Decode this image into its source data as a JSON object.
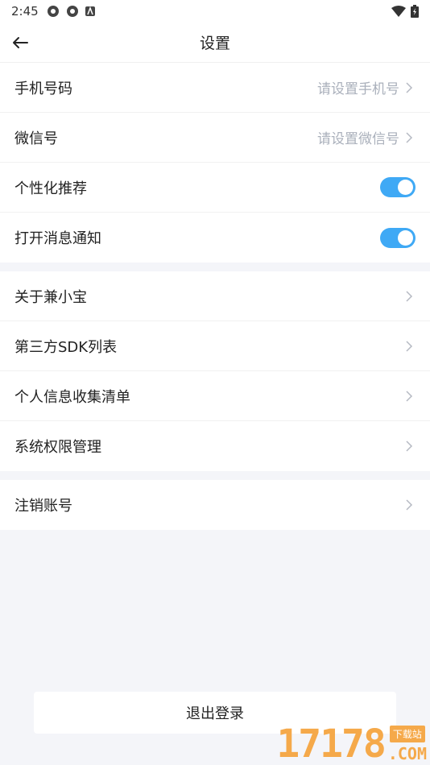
{
  "status_bar": {
    "time": "2:45"
  },
  "header": {
    "title": "设置"
  },
  "groups": [
    {
      "rows": [
        {
          "label": "手机号码",
          "hint": "请设置手机号"
        },
        {
          "label": "微信号",
          "hint": "请设置微信号"
        },
        {
          "label": "个性化推荐",
          "toggle_on": true
        },
        {
          "label": "打开消息通知",
          "toggle_on": true
        }
      ]
    },
    {
      "rows": [
        {
          "label": "关于兼小宝"
        },
        {
          "label": "第三方SDK列表"
        },
        {
          "label": "个人信息收集清单"
        },
        {
          "label": "系统权限管理"
        }
      ]
    },
    {
      "rows": [
        {
          "label": "注销账号"
        }
      ]
    }
  ],
  "logout_label": "退出登录",
  "watermark": {
    "digits": "17178",
    "tag": "下载站",
    "domain": ".COM"
  },
  "colors": {
    "toggle_on": "#3fa9f5",
    "hint": "#aab0bb",
    "watermark": "#f5a94a"
  }
}
